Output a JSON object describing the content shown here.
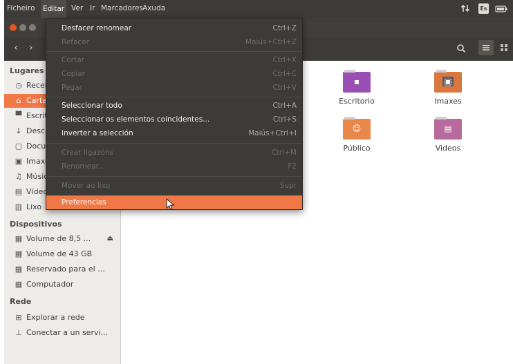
{
  "menubar": {
    "items": [
      "Ficheiro",
      "Editar",
      "Ver",
      "Ir",
      "Marcadores",
      "Axuda"
    ],
    "tray_icons": [
      "network-icon",
      "keyboard-layout-icon",
      "battery-icon"
    ],
    "keyboard_label": "Es"
  },
  "toolbar": {
    "back_icon": "‹",
    "forward_icon": "›",
    "search_icon": "search-icon",
    "view_icon": "list-view-icon",
    "grid_icon": "grid-view-icon"
  },
  "sidebar": {
    "places_header": "Lugares",
    "places": [
      {
        "icon": "recent-icon",
        "label": "Recentes"
      },
      {
        "icon": "home-icon",
        "label": "Cartafol persoal",
        "selected": true
      },
      {
        "icon": "desktop-icon",
        "label": "Escritorio"
      },
      {
        "icon": "downloads-icon",
        "label": "Descargas"
      },
      {
        "icon": "documents-icon",
        "label": "Documentos"
      },
      {
        "icon": "pictures-icon",
        "label": "Imaxes"
      },
      {
        "icon": "music-icon",
        "label": "Música"
      },
      {
        "icon": "videos-icon",
        "label": "Vídeos"
      },
      {
        "icon": "trash-icon",
        "label": "Lixo"
      }
    ],
    "devices_header": "Dispositivos",
    "devices": [
      {
        "icon": "drive-icon",
        "label": "Volume de 8,5 ...",
        "eject": true
      },
      {
        "icon": "drive-icon",
        "label": "Volume de 43 GB"
      },
      {
        "icon": "drive-icon",
        "label": "Reservado para el ..."
      },
      {
        "icon": "drive-icon",
        "label": "Computador"
      }
    ],
    "network_header": "Rede",
    "network": [
      {
        "icon": "network-browse-icon",
        "label": "Explorar a rede"
      },
      {
        "icon": "server-icon",
        "label": "Conectar a un servi..."
      }
    ]
  },
  "content": {
    "folders": [
      {
        "label": "Escritorio",
        "icon": "desktop-folder-icon",
        "color": "#9a4fb5"
      },
      {
        "label": "Imaxes",
        "icon": "pictures-folder-icon",
        "color": "#d8783f"
      },
      {
        "label": "Público",
        "icon": "public-folder-icon",
        "color": "#e8884a"
      },
      {
        "label": "Videos",
        "icon": "videos-folder-icon",
        "color": "#b86a9e"
      }
    ]
  },
  "edit_menu": {
    "items": [
      {
        "label": "Desfacer renomear",
        "accel": "Ctrl+Z",
        "enabled": true
      },
      {
        "label": "Refacer",
        "accel": "Maiús+Ctrl+Z",
        "enabled": false
      },
      {
        "label": "Cortar",
        "accel": "Ctrl+X",
        "enabled": false
      },
      {
        "label": "Copiar",
        "accel": "Ctrl+C",
        "enabled": false
      },
      {
        "label": "Pegar",
        "accel": "Ctrl+V",
        "enabled": false
      },
      {
        "label": "Seleccionar todo",
        "accel": "Ctrl+A",
        "enabled": true
      },
      {
        "label": "Seleccionar os elementos coincidentes...",
        "accel": "Ctrl+S",
        "enabled": true
      },
      {
        "label": "Inverter a selección",
        "accel": "Maiús+Ctrl+I",
        "enabled": true
      },
      {
        "label": "Crear ligazóns",
        "accel": "Ctrl+M",
        "enabled": false
      },
      {
        "label": "Renomear...",
        "accel": "F2",
        "enabled": false
      },
      {
        "label": "Mover ao lixo",
        "accel": "Supr",
        "enabled": false
      },
      {
        "label": "Preferencias",
        "accel": "",
        "enabled": true,
        "highlighted": true
      }
    ]
  },
  "colors": {
    "accent": "#f07746",
    "panel": "#3c3b37",
    "sidebar": "#edece9"
  }
}
